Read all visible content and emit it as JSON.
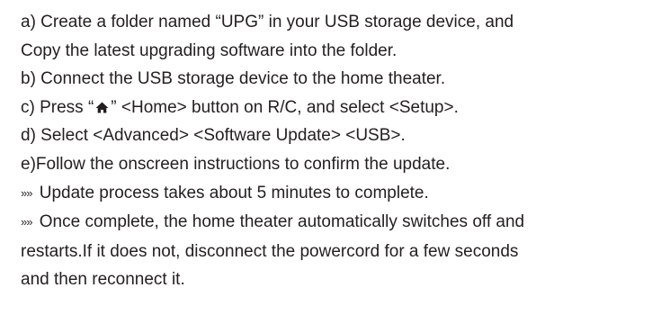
{
  "steps": {
    "a_line1": "a) Create a folder named “UPG” in your USB storage device, and",
    "a_line2": "Copy the latest upgrading software into the folder.",
    "b": "b) Connect the USB storage device to the home theater.",
    "c_prefix": "c) Press “",
    "c_home_icon": "home-icon",
    "c_suffix": "” <Home> button on R/C, and select <Setup>.",
    "d": "d) Select <Advanced> <Software Update> <USB>.",
    "e": "e)Follow the onscreen instructions to confirm the update."
  },
  "notes": {
    "marker": "»»",
    "note1": " Update process takes about 5 minutes to complete.",
    "note2_line1": " Once complete, the home theater automatically switches off and",
    "note2_line2": "restarts.If it does not, disconnect the powercord for a few seconds",
    "note2_line3": "and then reconnect it."
  }
}
